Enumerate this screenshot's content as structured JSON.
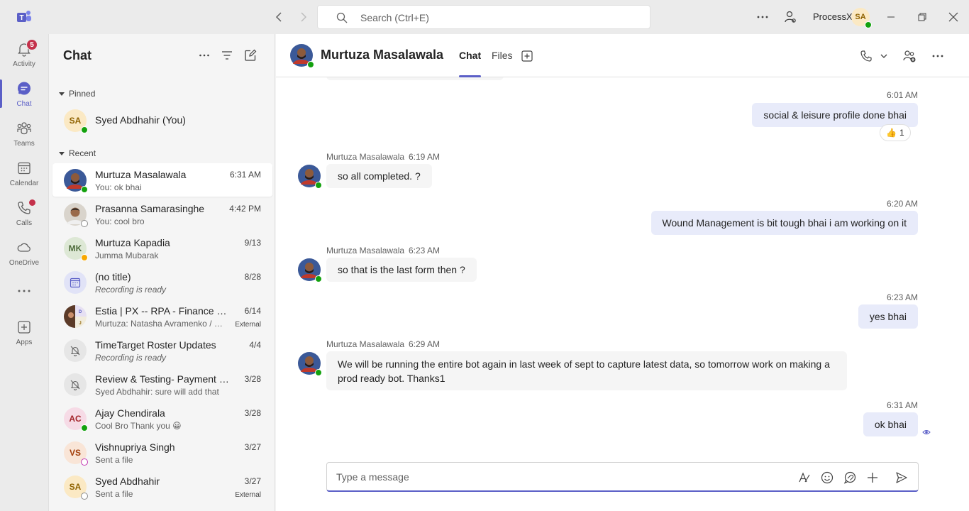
{
  "search": {
    "placeholder": "Search (Ctrl+E)"
  },
  "titlebar": {
    "org_name": "ProcessX",
    "user_initials": "SA"
  },
  "rail": [
    {
      "label": "Activity",
      "icon": "bell-icon",
      "badge": "5"
    },
    {
      "label": "Chat",
      "icon": "chat-icon",
      "active": true
    },
    {
      "label": "Teams",
      "icon": "teams-icon"
    },
    {
      "label": "Calendar",
      "icon": "calendar-icon"
    },
    {
      "label": "Calls",
      "icon": "phone-icon",
      "dot": true
    },
    {
      "label": "OneDrive",
      "icon": "cloud-icon"
    },
    {
      "label": "Apps",
      "icon": "apps-icon"
    }
  ],
  "chatlist": {
    "title": "Chat",
    "pinned_label": "Pinned",
    "recent_label": "Recent",
    "pinned": [
      {
        "name": "Syed Abdhahir (You)",
        "initials": "SA"
      }
    ],
    "recent": [
      {
        "name": "Murtuza Masalawala",
        "preview": "You: ok bhai",
        "time": "6:31 AM"
      },
      {
        "name": "Prasanna Samarasinghe",
        "preview": "You: cool bro",
        "time": "4:42 PM"
      },
      {
        "name": "Murtuza Kapadia",
        "preview": "Jumma Mubarak",
        "time": "9/13",
        "initials": "MK"
      },
      {
        "name": "(no title)",
        "preview": "Recording is ready",
        "time": "8/28"
      },
      {
        "name": "Estia | PX -- RPA - Finance Stre...",
        "preview": "Murtuza: Natasha Avramenko / De...",
        "time": "6/14",
        "tag": "External"
      },
      {
        "name": "TimeTarget Roster Updates",
        "preview": "Recording is ready",
        "time": "4/4"
      },
      {
        "name": "Review & Testing- Payment sta...",
        "preview": "Syed Abdhahir: sure will add that",
        "time": "3/28"
      },
      {
        "name": "Ajay Chendirala",
        "preview": "Cool Bro  Thank you 😀",
        "time": "3/28",
        "initials": "AC"
      },
      {
        "name": "Vishnupriya Singh",
        "preview": "Sent a file",
        "time": "3/27",
        "initials": "VS"
      },
      {
        "name": "Syed Abdhahir",
        "preview": "Sent a file",
        "time": "3/27",
        "initials": "SA",
        "tag": "External"
      }
    ]
  },
  "conversation": {
    "contact": "Murtuza Masalawala",
    "tabs": [
      "Chat",
      "Files"
    ],
    "messages": [
      {
        "from": "me",
        "time": "6:01 AM",
        "text": "social & leisure profile done bhai",
        "reaction": "👍",
        "reaction_count": "1"
      },
      {
        "from": "them",
        "sender": "Murtuza Masalawala",
        "time": "6:19 AM",
        "text": "so all completed. ?"
      },
      {
        "from": "me",
        "time": "6:20 AM",
        "text": "Wound Management is bit tough bhai i am working on it"
      },
      {
        "from": "them",
        "sender": "Murtuza Masalawala",
        "time": "6:23 AM",
        "text": "so that is the last form then ?"
      },
      {
        "from": "me",
        "time": "6:23 AM",
        "text": "yes bhai"
      },
      {
        "from": "them",
        "sender": "Murtuza Masalawala",
        "time": "6:29 AM",
        "text": "We will be running the entire bot again in last week of sept to capture latest data, so tomorrow work on making a prod ready bot. Thanks1"
      },
      {
        "from": "me",
        "time": "6:31 AM",
        "text": "ok bhai"
      }
    ]
  },
  "compose": {
    "placeholder": "Type a message"
  }
}
